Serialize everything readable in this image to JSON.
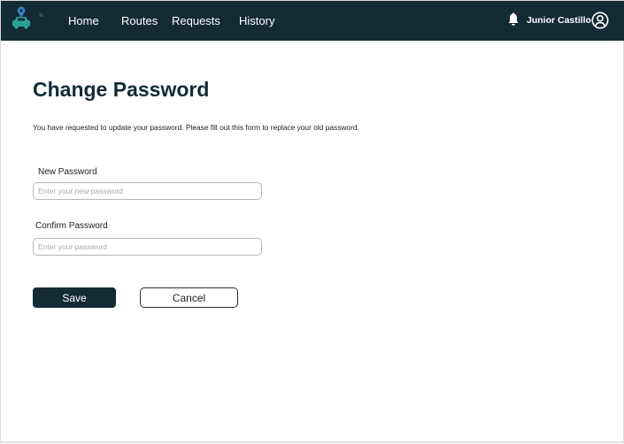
{
  "colors": {
    "navbar_bg": "#132b35",
    "primary": "#132b35",
    "logo_accent": "#2aa198",
    "logo_pin": "#3a86c8"
  },
  "navbar": {
    "logo_icon": "car-location-logo-icon",
    "links": [
      {
        "label": "Home"
      },
      {
        "label": "Routes"
      },
      {
        "label": "Requests"
      },
      {
        "label": "History"
      }
    ],
    "notification_icon": "bell-icon",
    "user_name": "Junior Castillo",
    "avatar_icon": "user-circle-icon"
  },
  "main": {
    "title": "Change Password",
    "description": "You have requested to update your password. Please fill out this form to replace your old password.",
    "new_password": {
      "label": "New Password",
      "placeholder": "Enter your new password",
      "value": ""
    },
    "confirm_password": {
      "label": "Confirm Password",
      "placeholder": "Enter your password",
      "value": ""
    },
    "save_label": "Save",
    "cancel_label": "Cancel"
  }
}
